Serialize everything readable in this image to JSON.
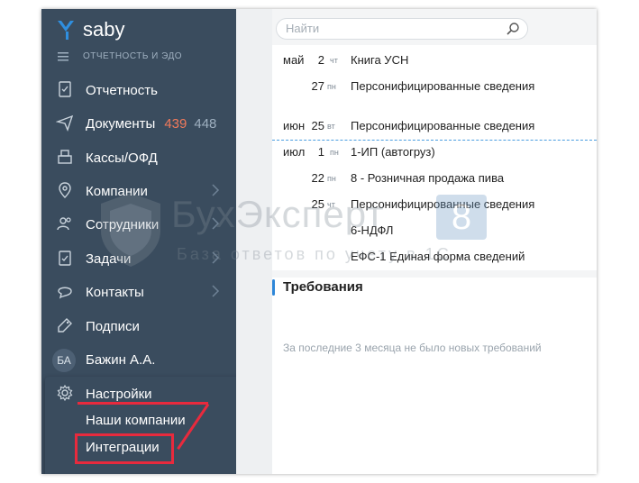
{
  "app": {
    "logo_text": "saby",
    "tagline": "ОТЧЕТНОСТЬ И ЭДО"
  },
  "sidebar": {
    "items": [
      {
        "label": "Отчетность",
        "icon": "report-icon"
      },
      {
        "label": "Документы",
        "icon": "send-icon",
        "badge_red": "439",
        "badge_gray": "448"
      },
      {
        "label": "Кассы/ОФД",
        "icon": "cash-register-icon"
      },
      {
        "label": "Компании",
        "icon": "companies-icon"
      },
      {
        "label": "Сотрудники",
        "icon": "employees-icon"
      },
      {
        "label": "Задачи",
        "icon": "tasks-icon"
      },
      {
        "label": "Контакты",
        "icon": "contacts-icon"
      },
      {
        "label": "Подписи",
        "icon": "signature-icon"
      },
      {
        "label": "Бажин А.А.",
        "avatar": "БА"
      }
    ],
    "settings": {
      "label": "Настройки",
      "icon": "gear-icon",
      "sub_items": [
        "Наши компании",
        "Интеграции"
      ]
    }
  },
  "search": {
    "placeholder": "Найти"
  },
  "calendar": {
    "rows": [
      {
        "month": "май",
        "day": "2",
        "dow": "чт",
        "text": "Книга УСН"
      },
      {
        "month": "",
        "day": "27",
        "dow": "пн",
        "text": "Персонифицированные сведения"
      },
      {
        "month": "июн",
        "day": "25",
        "dow": "вт",
        "text": "Персонифицированные сведения"
      },
      {
        "month": "июл",
        "day": "1",
        "dow": "пн",
        "text": "1-ИП (автогруз)"
      },
      {
        "month": "",
        "day": "22",
        "dow": "пн",
        "text": "8 - Розничная продажа пива"
      },
      {
        "month": "",
        "day": "25",
        "dow": "чт",
        "text": "Персонифицированные сведения"
      },
      {
        "month": "",
        "day": "",
        "dow": "",
        "text": "6-НДФЛ"
      },
      {
        "month": "",
        "day": "",
        "dow": "",
        "text": "ЕФС-1 Единая форма сведений"
      }
    ]
  },
  "requirements": {
    "title": "Требования",
    "empty": "За последние 3 месяца не было новых требований"
  },
  "watermark": {
    "title": "БухЭксперт",
    "digit": "8",
    "subtitle": "База ответов по учету в 1С"
  },
  "colors": {
    "sidebar_bg": "#3a4c5e",
    "badge_red": "#f27a5b",
    "highlight": "#e82a3d",
    "accent": "#2d86d8"
  }
}
